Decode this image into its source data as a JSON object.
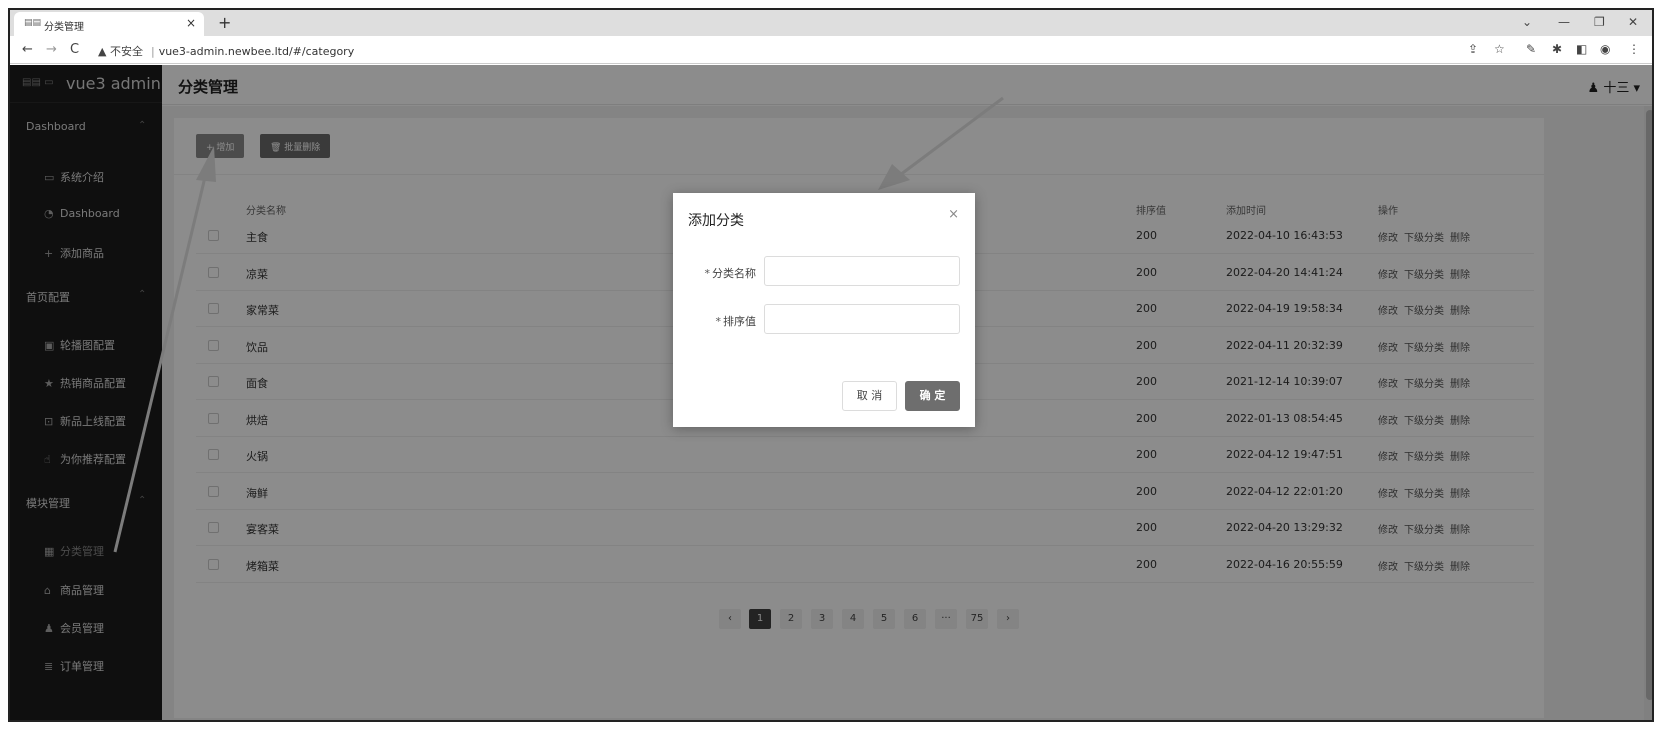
{
  "browser": {
    "tab_title": "分类管理",
    "tab_close": "×",
    "new_tab": "+",
    "url_warning": "▲ 不安全",
    "url_sep": "|",
    "url": "vue3-admin.newbee.ltd/#/category"
  },
  "sidebar": {
    "logo_text": "vue3 admin",
    "groups": [
      {
        "label": "Dashboard"
      },
      {
        "label": "首页配置"
      },
      {
        "label": "模块管理"
      }
    ],
    "items": [
      {
        "label": "系统介绍"
      },
      {
        "label": "Dashboard"
      },
      {
        "label": "添加商品"
      },
      {
        "label": "轮播图配置"
      },
      {
        "label": "热销商品配置"
      },
      {
        "label": "新品上线配置"
      },
      {
        "label": "为你推荐配置"
      },
      {
        "label": "分类管理"
      },
      {
        "label": "商品管理"
      },
      {
        "label": "会员管理"
      },
      {
        "label": "订单管理"
      }
    ]
  },
  "header": {
    "page_title": "分类管理",
    "user": "十三"
  },
  "toolbar": {
    "add_label": "+ 增加",
    "batch_delete_label": "🗑 批量删除"
  },
  "table": {
    "columns": [
      "分类名称",
      "排序值",
      "添加时间",
      "操作"
    ],
    "rows": [
      {
        "name": "主食",
        "rank": "200",
        "time": "2022-04-10 16:43:53"
      },
      {
        "name": "凉菜",
        "rank": "200",
        "time": "2022-04-20 14:41:24"
      },
      {
        "name": "家常菜",
        "rank": "200",
        "time": "2022-04-19 19:58:34"
      },
      {
        "name": "饮品",
        "rank": "200",
        "time": "2022-04-11 20:32:39"
      },
      {
        "name": "面食",
        "rank": "200",
        "time": "2021-12-14 10:39:07"
      },
      {
        "name": "烘焙",
        "rank": "200",
        "time": "2022-01-13 08:54:45"
      },
      {
        "name": "火锅",
        "rank": "200",
        "time": "2022-04-12 19:47:51"
      },
      {
        "name": "海鲜",
        "rank": "200",
        "time": "2022-04-12 22:01:20"
      },
      {
        "name": "宴客菜",
        "rank": "200",
        "time": "2022-04-20 13:29:32"
      },
      {
        "name": "烤箱菜",
        "rank": "200",
        "time": "2022-04-16 20:55:59"
      }
    ],
    "actions": {
      "edit": "修改",
      "sub": "下级分类",
      "delete": "删除"
    }
  },
  "pagination": {
    "prev": "‹",
    "pages": [
      "1",
      "2",
      "3",
      "4",
      "5",
      "6",
      "···",
      "75"
    ],
    "current": "1",
    "next": "›"
  },
  "dialog": {
    "title": "添加分类",
    "close": "×",
    "fields": [
      {
        "label": "分类名称",
        "value": ""
      },
      {
        "label": "排序值",
        "value": ""
      }
    ],
    "required_mark": "*",
    "cancel_label": "取 消",
    "ok_label": "确 定"
  },
  "icons": {
    "back": "back-arrow-icon",
    "forward": "forward-arrow-icon",
    "reload": "reload-icon"
  }
}
